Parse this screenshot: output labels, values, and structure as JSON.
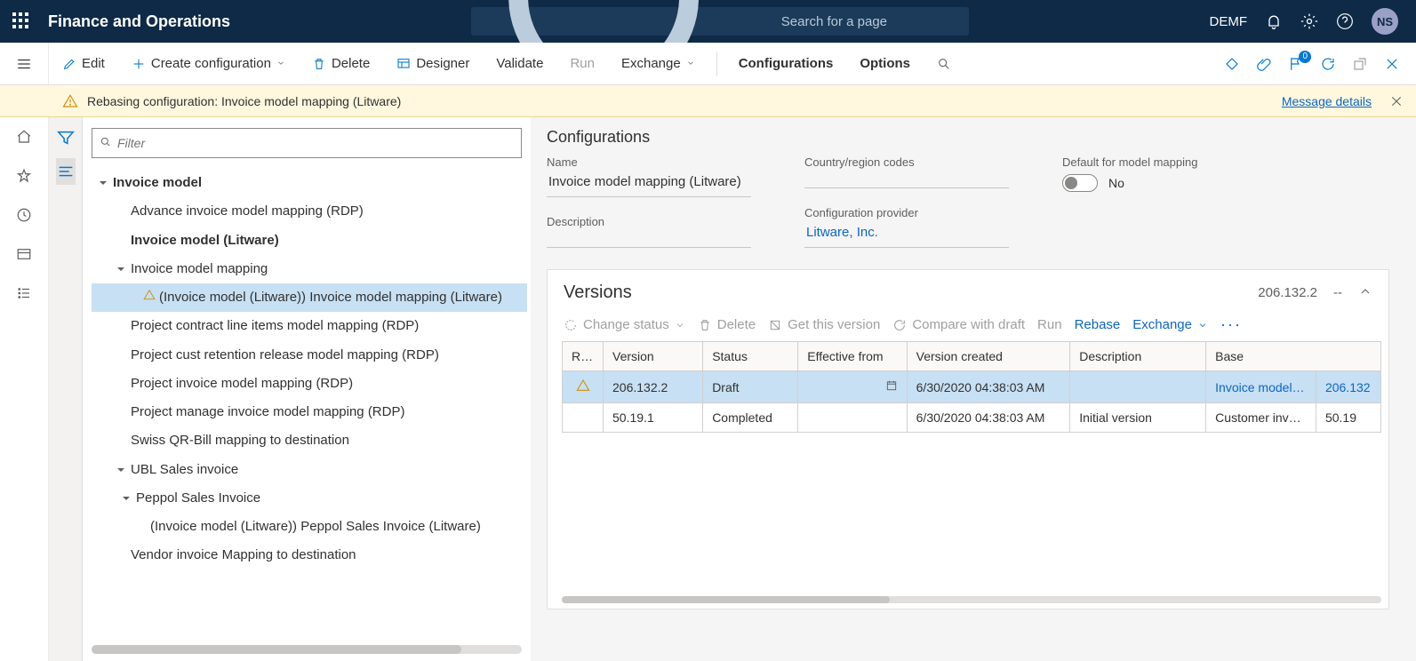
{
  "header": {
    "app_title": "Finance and Operations",
    "search_placeholder": "Search for a page",
    "company": "DEMF",
    "user_initials": "NS"
  },
  "cmdbar": {
    "edit": "Edit",
    "create_config": "Create configuration",
    "delete": "Delete",
    "designer": "Designer",
    "validate": "Validate",
    "run": "Run",
    "exchange": "Exchange",
    "configurations": "Configurations",
    "options": "Options"
  },
  "warning": {
    "text": "Rebasing configuration: Invoice model mapping (Litware)",
    "details_link": "Message details"
  },
  "filter_placeholder": "Filter",
  "tree": {
    "n0": "Invoice model",
    "n1": "Advance invoice model mapping (RDP)",
    "n2": "Invoice model (Litware)",
    "n3": "Invoice model mapping",
    "n4": "(Invoice model (Litware)) Invoice model mapping (Litware)",
    "n5": "Project contract line items model mapping (RDP)",
    "n6": "Project cust retention release model mapping (RDP)",
    "n7": "Project invoice model mapping (RDP)",
    "n8": "Project manage invoice model mapping (RDP)",
    "n9": "Swiss QR-Bill mapping to destination",
    "n10": "UBL Sales invoice",
    "n11": "Peppol Sales Invoice",
    "n12": "(Invoice model (Litware)) Peppol Sales Invoice (Litware)",
    "n13": "Vendor invoice Mapping to destination"
  },
  "config": {
    "section_title": "Configurations",
    "labels": {
      "name": "Name",
      "country": "Country/region codes",
      "default_mapping": "Default for model mapping",
      "description": "Description",
      "provider": "Configuration provider"
    },
    "name": "Invoice model mapping (Litware)",
    "country": "",
    "default_mapping_value": "No",
    "description": "",
    "provider": "Litware, Inc."
  },
  "versions": {
    "title": "Versions",
    "current": "206.132.2",
    "navdash": "--",
    "toolbar": {
      "change_status": "Change status",
      "delete": "Delete",
      "get_version": "Get this version",
      "compare": "Compare with draft",
      "run": "Run",
      "rebase": "Rebase",
      "exchange": "Exchange"
    },
    "columns": {
      "r": "R…",
      "version": "Version",
      "status": "Status",
      "effective": "Effective from",
      "created": "Version created",
      "description": "Description",
      "base": "Base",
      "base_num": ""
    },
    "rows": [
      {
        "warn": true,
        "version": "206.132.2",
        "status": "Draft",
        "effective": "",
        "created": "6/30/2020 04:38:03 AM",
        "description": "",
        "base": "Invoice model…",
        "base_num": "206.132"
      },
      {
        "warn": false,
        "version": "50.19.1",
        "status": "Completed",
        "effective": "",
        "created": "6/30/2020 04:38:03 AM",
        "description": "Initial version",
        "base": "Customer inv…",
        "base_num": "50.19"
      }
    ]
  }
}
